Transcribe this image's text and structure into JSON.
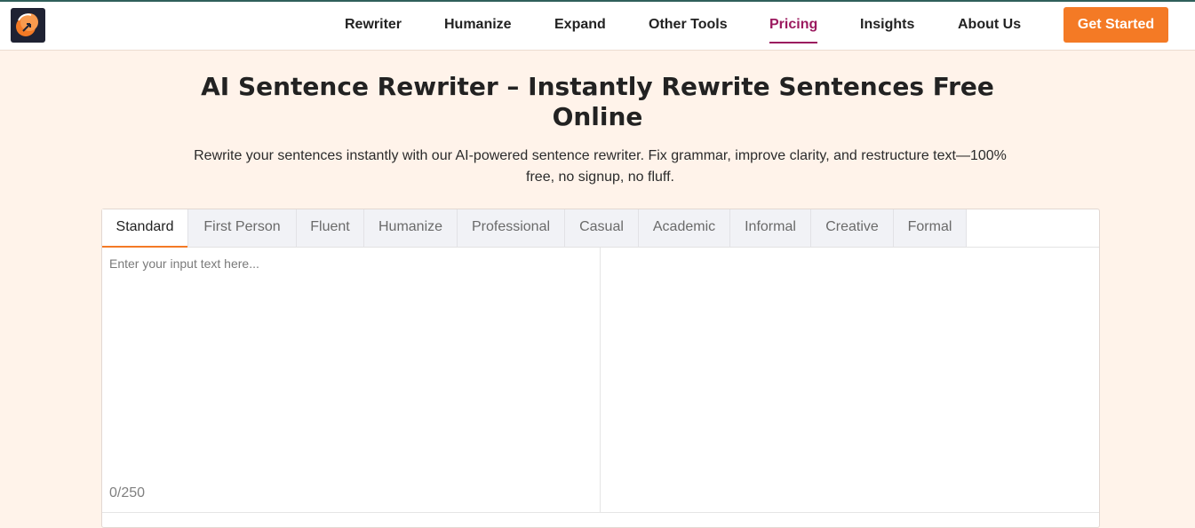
{
  "nav": {
    "items": [
      {
        "label": "Rewriter"
      },
      {
        "label": "Humanize"
      },
      {
        "label": "Expand"
      },
      {
        "label": "Other Tools"
      },
      {
        "label": "Pricing",
        "active": true
      },
      {
        "label": "Insights"
      },
      {
        "label": "About Us"
      }
    ],
    "cta_label": "Get Started"
  },
  "logo": {
    "icon": "brand-logo-icon"
  },
  "hero": {
    "title": "AI Sentence Rewriter – Instantly Rewrite Sentences Free Online",
    "subtitle": "Rewrite your sentences instantly with our AI-powered sentence rewriter. Fix grammar, improve clarity, and restructure text—100% free, no signup, no fluff."
  },
  "editor": {
    "tabs": [
      {
        "label": "Standard",
        "active": true
      },
      {
        "label": "First Person"
      },
      {
        "label": "Fluent"
      },
      {
        "label": "Humanize"
      },
      {
        "label": "Professional"
      },
      {
        "label": "Casual"
      },
      {
        "label": "Academic"
      },
      {
        "label": "Informal"
      },
      {
        "label": "Creative"
      },
      {
        "label": "Formal"
      }
    ],
    "input_placeholder": "Enter your input text here...",
    "input_value": "",
    "counter": "0/250"
  },
  "colors": {
    "accent": "#f47a25",
    "active_nav": "#9b1a5f",
    "background": "#fff3ea"
  }
}
